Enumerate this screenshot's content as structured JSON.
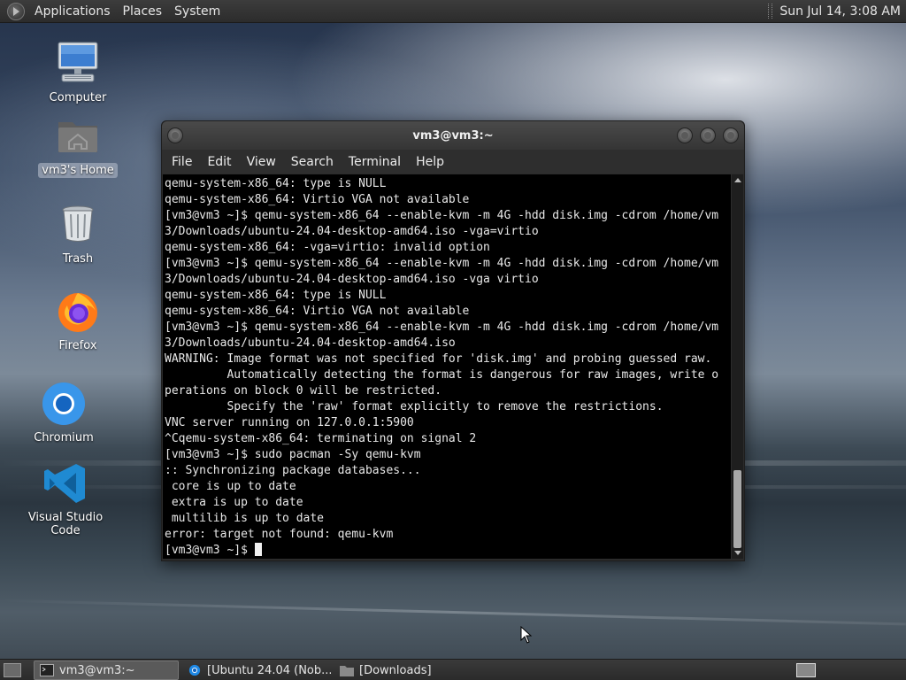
{
  "top_panel": {
    "menus": [
      "Applications",
      "Places",
      "System"
    ],
    "clock": "Sun Jul 14,  3:08 AM"
  },
  "desktop": {
    "icons": [
      {
        "label": "Computer",
        "icon": "computer-icon"
      },
      {
        "label": "vm3's Home",
        "icon": "home-folder-icon",
        "selected": true
      },
      {
        "label": "Trash",
        "icon": "trash-icon"
      },
      {
        "label": "Firefox",
        "icon": "firefox-icon"
      },
      {
        "label": "Chromium",
        "icon": "chromium-icon"
      },
      {
        "label": "Visual Studio Code",
        "icon": "vscode-icon"
      }
    ]
  },
  "terminal": {
    "title": "vm3@vm3:~",
    "menu": [
      "File",
      "Edit",
      "View",
      "Search",
      "Terminal",
      "Help"
    ],
    "lines": [
      "qemu-system-x86_64: type is NULL",
      "qemu-system-x86_64: Virtio VGA not available",
      "[vm3@vm3 ~]$ qemu-system-x86_64 --enable-kvm -m 4G -hdd disk.img -cdrom /home/vm",
      "3/Downloads/ubuntu-24.04-desktop-amd64.iso -vga=virtio",
      "qemu-system-x86_64: -vga=virtio: invalid option",
      "[vm3@vm3 ~]$ qemu-system-x86_64 --enable-kvm -m 4G -hdd disk.img -cdrom /home/vm",
      "3/Downloads/ubuntu-24.04-desktop-amd64.iso -vga virtio",
      "qemu-system-x86_64: type is NULL",
      "qemu-system-x86_64: Virtio VGA not available",
      "[vm3@vm3 ~]$ qemu-system-x86_64 --enable-kvm -m 4G -hdd disk.img -cdrom /home/vm",
      "3/Downloads/ubuntu-24.04-desktop-amd64.iso",
      "WARNING: Image format was not specified for 'disk.img' and probing guessed raw.",
      "         Automatically detecting the format is dangerous for raw images, write o",
      "perations on block 0 will be restricted.",
      "         Specify the 'raw' format explicitly to remove the restrictions.",
      "VNC server running on 127.0.0.1:5900",
      "^Cqemu-system-x86_64: terminating on signal 2",
      "[vm3@vm3 ~]$ sudo pacman -Sy qemu-kvm",
      ":: Synchronizing package databases...",
      " core is up to date",
      " extra is up to date",
      " multilib is up to date",
      "error: target not found: qemu-kvm"
    ],
    "prompt": "[vm3@vm3 ~]$ "
  },
  "taskbar": {
    "tasks": [
      {
        "label": "vm3@vm3:~",
        "icon": "terminal-icon",
        "active": true
      },
      {
        "label": "[Ubuntu 24.04 (Nob...",
        "icon": "chromium-icon",
        "active": false
      },
      {
        "label": "[Downloads]",
        "icon": "folder-icon",
        "active": false
      }
    ]
  }
}
